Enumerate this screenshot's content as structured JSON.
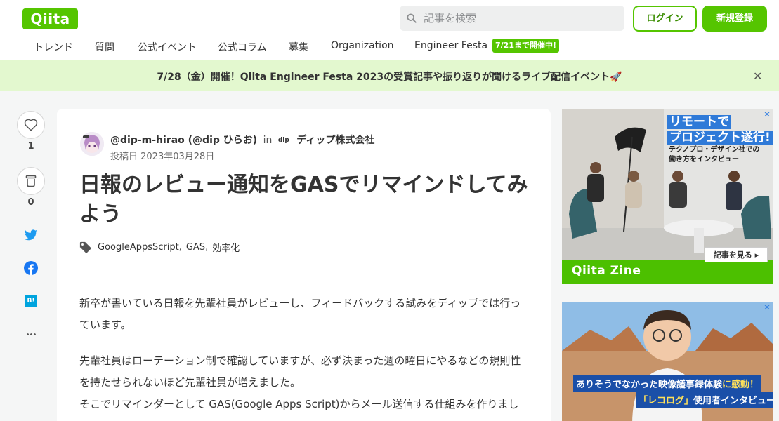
{
  "header": {
    "logo_text": "Qiita",
    "search_placeholder": "記事を検索",
    "login_label": "ログイン",
    "signup_label": "新規登録"
  },
  "nav": {
    "items": [
      {
        "label": "トレンド"
      },
      {
        "label": "質問"
      },
      {
        "label": "公式イベント"
      },
      {
        "label": "公式コラム"
      },
      {
        "label": "募集"
      },
      {
        "label": "Organization"
      },
      {
        "label": "Engineer Festa"
      }
    ],
    "festa_badge": "7/21まで開催中!"
  },
  "banner": {
    "text": "7/28（金）開催！Qiita Engineer Festa 2023の受賞記事や振り返りが聞けるライブ配信イベント🚀",
    "close_symbol": "✕"
  },
  "rail": {
    "like_count": "1",
    "stock_count": "0",
    "more_symbol": "•••",
    "hatena_label": "B!"
  },
  "article": {
    "author_handle": "@dip-m-hirao (@dip ひらお)",
    "in_label": "in",
    "org_logo_text": "dip",
    "org_name": "ディップ株式会社",
    "posted_date": "投稿日 2023年03月28日",
    "title": "日報のレビュー通知をGASでリマインドしてみよう",
    "tags": [
      {
        "label": "GoogleAppsScript"
      },
      {
        "label": "GAS"
      },
      {
        "label": "効率化"
      }
    ],
    "tag_separator": ",",
    "paragraphs": [
      "新卒が書いている日報を先輩社員がレビューし、フィードバックする試みをディップでは行っています。",
      "先輩社員はローテーション制で確認していますが、必ず決まった週の曜日にやるなどの規則性を持たせられないほど先輩社員が増えました。",
      "そこでリマインダーとして GAS(Google Apps Script)からメール送信する仕組みを作りました。"
    ]
  },
  "ads": {
    "ad1": {
      "headline_line1": "リモートで",
      "headline_line2": "プロジェクト遂行!",
      "sub_line1": "テクノプロ・デザイン社での",
      "sub_line2": "働き方をインタビュー",
      "cta": "記事を見る ▸",
      "brand": "Qiita Zine",
      "close_symbol": "✕"
    },
    "ad2": {
      "caption1_pre": "ありそうでなかった映像議事録体験",
      "caption1_hl": "に感動！",
      "caption2_hl": "「レコログ」",
      "caption2_post": "使用者インタビュー",
      "close_symbol": "✕"
    }
  },
  "colors": {
    "brand_green": "#55c500",
    "banner_bg": "#e3f8cf",
    "twitter": "#1d9bf0",
    "facebook": "#1877f2",
    "hatena": "#00a4de"
  }
}
